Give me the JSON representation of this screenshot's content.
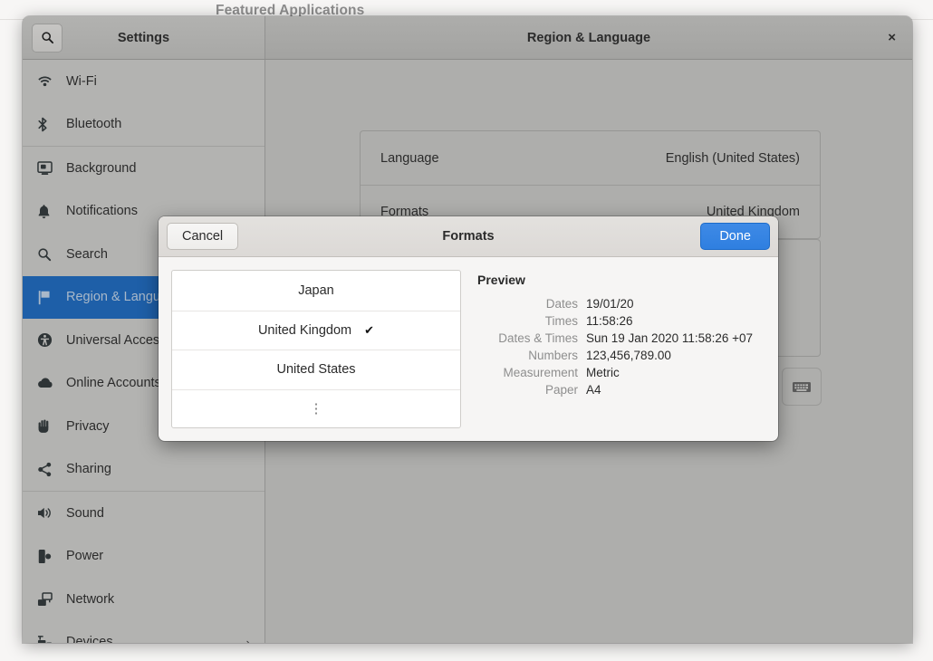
{
  "desktop": {
    "background_heading": "Featured Applications"
  },
  "window": {
    "sidebar_title": "Settings",
    "content_title": "Region & Language",
    "close_label": "×",
    "search_icon": "search-icon"
  },
  "sidebar": {
    "groups": [
      {
        "items": [
          {
            "label": "Wi-Fi",
            "icon": "wifi-icon",
            "selected": false
          },
          {
            "label": "Bluetooth",
            "icon": "bluetooth-icon",
            "selected": false
          }
        ]
      },
      {
        "items": [
          {
            "label": "Background",
            "icon": "background-icon",
            "selected": false
          },
          {
            "label": "Notifications",
            "icon": "bell-icon",
            "selected": false
          },
          {
            "label": "Search",
            "icon": "search-icon",
            "selected": false
          },
          {
            "label": "Region & Language",
            "icon": "flag-icon",
            "selected": true
          },
          {
            "label": "Universal Access",
            "icon": "accessibility-icon",
            "selected": false
          },
          {
            "label": "Online Accounts",
            "icon": "cloud-icon",
            "selected": false
          },
          {
            "label": "Privacy",
            "icon": "hand-icon",
            "selected": false
          },
          {
            "label": "Sharing",
            "icon": "share-icon",
            "selected": false
          }
        ]
      },
      {
        "items": [
          {
            "label": "Sound",
            "icon": "speaker-icon",
            "selected": false
          },
          {
            "label": "Power",
            "icon": "power-icon",
            "selected": false
          },
          {
            "label": "Network",
            "icon": "network-icon",
            "selected": false
          },
          {
            "label": "Devices",
            "icon": "devices-icon",
            "selected": false,
            "chevron": "›"
          }
        ]
      }
    ]
  },
  "main": {
    "rows": [
      {
        "key": "Language",
        "value": "English (United States)"
      },
      {
        "key": "Formats",
        "value": "United Kingdom"
      }
    ],
    "keyboard_button_icon": "keyboard-icon"
  },
  "dialog": {
    "title": "Formats",
    "cancel_label": "Cancel",
    "done_label": "Done",
    "accent_color": "#3584e4",
    "list": [
      {
        "label": "Japan",
        "checked": false
      },
      {
        "label": "United Kingdom",
        "checked": true
      },
      {
        "label": "United States",
        "checked": false
      },
      {
        "label": "⋮",
        "checked": false,
        "is_more": true
      }
    ],
    "check_glyph": "✔",
    "preview": {
      "title": "Preview",
      "rows": [
        {
          "key": "Dates",
          "value": "19/01/20"
        },
        {
          "key": "Times",
          "value": "11:58:26"
        },
        {
          "key": "Dates & Times",
          "value": "Sun 19 Jan 2020 11:58:26 +07"
        },
        {
          "key": "Numbers",
          "value": "123,456,789.00"
        },
        {
          "key": "Measurement",
          "value": "Metric"
        },
        {
          "key": "Paper",
          "value": "A4"
        }
      ]
    }
  }
}
